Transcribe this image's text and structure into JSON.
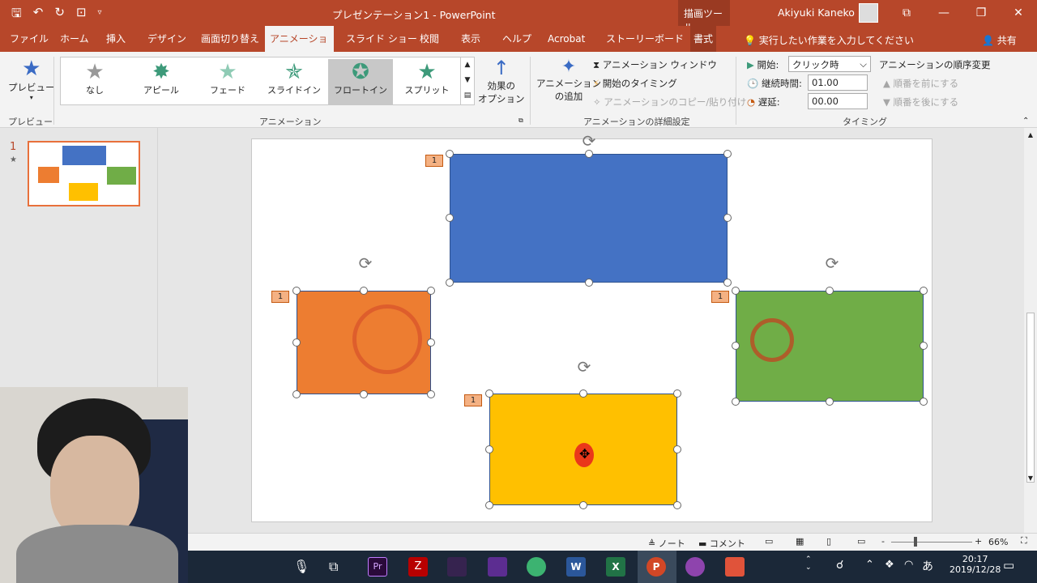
{
  "titlebar": {
    "title": "プレゼンテーション1 - PowerPoint",
    "context_tab_title": "描画ツール",
    "user": "Akiyuki Kaneko"
  },
  "tabs": [
    {
      "label": "ファイル"
    },
    {
      "label": "ホーム"
    },
    {
      "label": "挿入"
    },
    {
      "label": "デザイン"
    },
    {
      "label": "画面切り替え"
    },
    {
      "label": "アニメーション",
      "active": true
    },
    {
      "label": "スライド ショー"
    },
    {
      "label": "校閲"
    },
    {
      "label": "表示"
    },
    {
      "label": "ヘルプ"
    },
    {
      "label": "Acrobat"
    },
    {
      "label": "ストーリーボード"
    },
    {
      "label": "書式"
    }
  ],
  "tellme": "実行したい作業を入力してください",
  "share": "共有",
  "ribbon": {
    "preview": {
      "label": "プレビュー",
      "group": "プレビュー"
    },
    "animation_group": "アニメーション",
    "gallery": [
      {
        "label": "なし",
        "icon": "star-gray-icon"
      },
      {
        "label": "アピール",
        "icon": "star-burst-icon"
      },
      {
        "label": "フェード",
        "icon": "star-fade-icon"
      },
      {
        "label": "スライドイン",
        "icon": "star-flyin-icon"
      },
      {
        "label": "フロートイン",
        "icon": "star-float-icon",
        "selected": true
      },
      {
        "label": "スプリット",
        "icon": "star-split-icon"
      }
    ],
    "effect_options": {
      "line1": "効果の",
      "line2": "オプション"
    },
    "advanced": {
      "group": "アニメーションの詳細設定",
      "add_line1": "アニメーション",
      "add_line2": "の追加",
      "pane": "アニメーション ウィンドウ",
      "trigger": "開始のタイミング",
      "painter": "アニメーションのコピー/貼り付け"
    },
    "timing": {
      "group": "タイミング",
      "start_label": "開始:",
      "start_value": "クリック時",
      "duration_label": "継続時間:",
      "duration_value": "01.00",
      "delay_label": "遅延:",
      "delay_value": "00.00",
      "reorder": "アニメーションの順序変更",
      "move_earlier": "順番を前にする",
      "move_later": "順番を後にする"
    }
  },
  "slides": [
    {
      "number": "1",
      "marker": "★"
    }
  ],
  "canvas": {
    "shapes": [
      {
        "name": "blue",
        "color": "#4472c4",
        "tag": "1"
      },
      {
        "name": "orange",
        "color": "#ed7d31",
        "tag": "1"
      },
      {
        "name": "green",
        "color": "#70ad47",
        "tag": "1"
      },
      {
        "name": "yellow",
        "color": "#ffc000",
        "tag": "1"
      }
    ]
  },
  "status": {
    "notes": "ノート",
    "comments": "コメント",
    "zoom_minus": "-",
    "zoom_plus": "+",
    "zoom": "66%"
  },
  "taskbar": {
    "time": "20:17",
    "date": "2019/12/28",
    "ime": "あ"
  }
}
